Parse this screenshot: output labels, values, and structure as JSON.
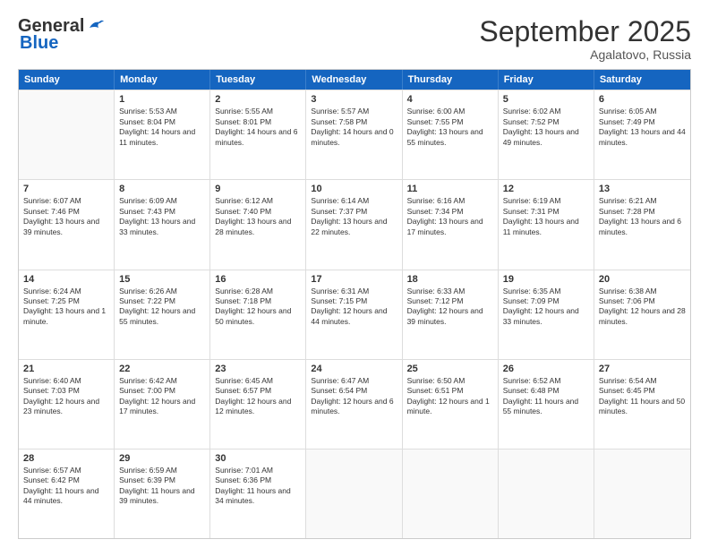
{
  "header": {
    "logo_general": "General",
    "logo_blue": "Blue",
    "month_title": "September 2025",
    "location": "Agalatovo, Russia"
  },
  "days_of_week": [
    "Sunday",
    "Monday",
    "Tuesday",
    "Wednesday",
    "Thursday",
    "Friday",
    "Saturday"
  ],
  "weeks": [
    [
      {
        "day": "",
        "empty": true
      },
      {
        "day": "1",
        "sunrise": "Sunrise: 5:53 AM",
        "sunset": "Sunset: 8:04 PM",
        "daylight": "Daylight: 14 hours and 11 minutes."
      },
      {
        "day": "2",
        "sunrise": "Sunrise: 5:55 AM",
        "sunset": "Sunset: 8:01 PM",
        "daylight": "Daylight: 14 hours and 6 minutes."
      },
      {
        "day": "3",
        "sunrise": "Sunrise: 5:57 AM",
        "sunset": "Sunset: 7:58 PM",
        "daylight": "Daylight: 14 hours and 0 minutes."
      },
      {
        "day": "4",
        "sunrise": "Sunrise: 6:00 AM",
        "sunset": "Sunset: 7:55 PM",
        "daylight": "Daylight: 13 hours and 55 minutes."
      },
      {
        "day": "5",
        "sunrise": "Sunrise: 6:02 AM",
        "sunset": "Sunset: 7:52 PM",
        "daylight": "Daylight: 13 hours and 49 minutes."
      },
      {
        "day": "6",
        "sunrise": "Sunrise: 6:05 AM",
        "sunset": "Sunset: 7:49 PM",
        "daylight": "Daylight: 13 hours and 44 minutes."
      }
    ],
    [
      {
        "day": "7",
        "sunrise": "Sunrise: 6:07 AM",
        "sunset": "Sunset: 7:46 PM",
        "daylight": "Daylight: 13 hours and 39 minutes."
      },
      {
        "day": "8",
        "sunrise": "Sunrise: 6:09 AM",
        "sunset": "Sunset: 7:43 PM",
        "daylight": "Daylight: 13 hours and 33 minutes."
      },
      {
        "day": "9",
        "sunrise": "Sunrise: 6:12 AM",
        "sunset": "Sunset: 7:40 PM",
        "daylight": "Daylight: 13 hours and 28 minutes."
      },
      {
        "day": "10",
        "sunrise": "Sunrise: 6:14 AM",
        "sunset": "Sunset: 7:37 PM",
        "daylight": "Daylight: 13 hours and 22 minutes."
      },
      {
        "day": "11",
        "sunrise": "Sunrise: 6:16 AM",
        "sunset": "Sunset: 7:34 PM",
        "daylight": "Daylight: 13 hours and 17 minutes."
      },
      {
        "day": "12",
        "sunrise": "Sunrise: 6:19 AM",
        "sunset": "Sunset: 7:31 PM",
        "daylight": "Daylight: 13 hours and 11 minutes."
      },
      {
        "day": "13",
        "sunrise": "Sunrise: 6:21 AM",
        "sunset": "Sunset: 7:28 PM",
        "daylight": "Daylight: 13 hours and 6 minutes."
      }
    ],
    [
      {
        "day": "14",
        "sunrise": "Sunrise: 6:24 AM",
        "sunset": "Sunset: 7:25 PM",
        "daylight": "Daylight: 13 hours and 1 minute."
      },
      {
        "day": "15",
        "sunrise": "Sunrise: 6:26 AM",
        "sunset": "Sunset: 7:22 PM",
        "daylight": "Daylight: 12 hours and 55 minutes."
      },
      {
        "day": "16",
        "sunrise": "Sunrise: 6:28 AM",
        "sunset": "Sunset: 7:18 PM",
        "daylight": "Daylight: 12 hours and 50 minutes."
      },
      {
        "day": "17",
        "sunrise": "Sunrise: 6:31 AM",
        "sunset": "Sunset: 7:15 PM",
        "daylight": "Daylight: 12 hours and 44 minutes."
      },
      {
        "day": "18",
        "sunrise": "Sunrise: 6:33 AM",
        "sunset": "Sunset: 7:12 PM",
        "daylight": "Daylight: 12 hours and 39 minutes."
      },
      {
        "day": "19",
        "sunrise": "Sunrise: 6:35 AM",
        "sunset": "Sunset: 7:09 PM",
        "daylight": "Daylight: 12 hours and 33 minutes."
      },
      {
        "day": "20",
        "sunrise": "Sunrise: 6:38 AM",
        "sunset": "Sunset: 7:06 PM",
        "daylight": "Daylight: 12 hours and 28 minutes."
      }
    ],
    [
      {
        "day": "21",
        "sunrise": "Sunrise: 6:40 AM",
        "sunset": "Sunset: 7:03 PM",
        "daylight": "Daylight: 12 hours and 23 minutes."
      },
      {
        "day": "22",
        "sunrise": "Sunrise: 6:42 AM",
        "sunset": "Sunset: 7:00 PM",
        "daylight": "Daylight: 12 hours and 17 minutes."
      },
      {
        "day": "23",
        "sunrise": "Sunrise: 6:45 AM",
        "sunset": "Sunset: 6:57 PM",
        "daylight": "Daylight: 12 hours and 12 minutes."
      },
      {
        "day": "24",
        "sunrise": "Sunrise: 6:47 AM",
        "sunset": "Sunset: 6:54 PM",
        "daylight": "Daylight: 12 hours and 6 minutes."
      },
      {
        "day": "25",
        "sunrise": "Sunrise: 6:50 AM",
        "sunset": "Sunset: 6:51 PM",
        "daylight": "Daylight: 12 hours and 1 minute."
      },
      {
        "day": "26",
        "sunrise": "Sunrise: 6:52 AM",
        "sunset": "Sunset: 6:48 PM",
        "daylight": "Daylight: 11 hours and 55 minutes."
      },
      {
        "day": "27",
        "sunrise": "Sunrise: 6:54 AM",
        "sunset": "Sunset: 6:45 PM",
        "daylight": "Daylight: 11 hours and 50 minutes."
      }
    ],
    [
      {
        "day": "28",
        "sunrise": "Sunrise: 6:57 AM",
        "sunset": "Sunset: 6:42 PM",
        "daylight": "Daylight: 11 hours and 44 minutes."
      },
      {
        "day": "29",
        "sunrise": "Sunrise: 6:59 AM",
        "sunset": "Sunset: 6:39 PM",
        "daylight": "Daylight: 11 hours and 39 minutes."
      },
      {
        "day": "30",
        "sunrise": "Sunrise: 7:01 AM",
        "sunset": "Sunset: 6:36 PM",
        "daylight": "Daylight: 11 hours and 34 minutes."
      },
      {
        "day": "",
        "empty": true
      },
      {
        "day": "",
        "empty": true
      },
      {
        "day": "",
        "empty": true
      },
      {
        "day": "",
        "empty": true
      }
    ]
  ]
}
